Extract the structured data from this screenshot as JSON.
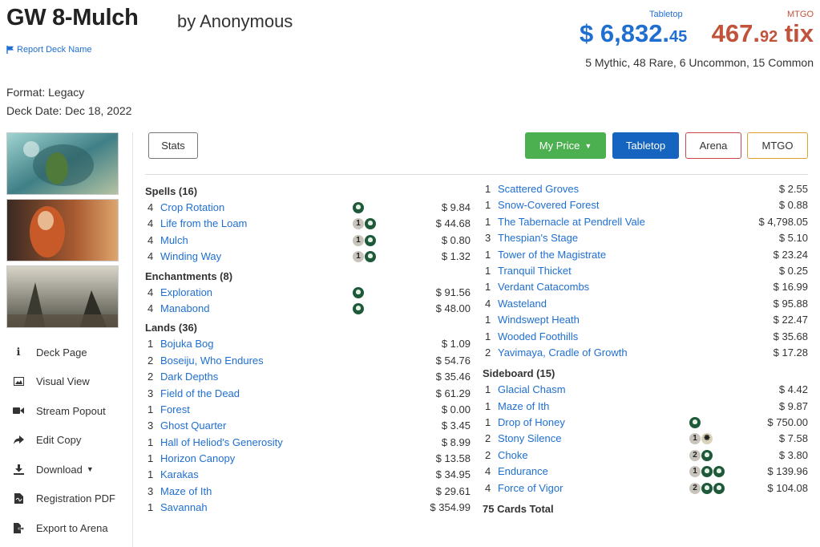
{
  "header": {
    "title": "GW 8-Mulch",
    "author": "by Anonymous",
    "report_link": "Report Deck Name",
    "tabletop_label": "Tabletop",
    "mtgo_label": "MTGO",
    "tabletop_price_main": "$ 6,832.",
    "tabletop_price_cents": "45",
    "mtgo_price_main": "467.",
    "mtgo_price_cents": "92",
    "mtgo_price_unit": " tix",
    "rarity_summary": "5 Mythic, 48 Rare, 6 Uncommon, 15 Common"
  },
  "meta": {
    "format": "Format: Legacy",
    "deck_date": "Deck Date: Dec 18, 2022"
  },
  "sidebar": {
    "menu": [
      {
        "label": "Deck Page",
        "icon": "info-icon"
      },
      {
        "label": "Visual View",
        "icon": "image-icon"
      },
      {
        "label": "Stream Popout",
        "icon": "video-icon"
      },
      {
        "label": "Edit Copy",
        "icon": "share-icon"
      },
      {
        "label": "Download",
        "icon": "download-icon"
      },
      {
        "label": "Registration PDF",
        "icon": "pdf-icon"
      },
      {
        "label": "Export to Arena",
        "icon": "export-icon"
      }
    ]
  },
  "toolbar": {
    "stats": "Stats",
    "my_price": "My Price",
    "tabletop": "Tabletop",
    "arena": "Arena",
    "mtgo": "MTGO"
  },
  "colors": {
    "tabletop_blue": "#1f6fd1",
    "mtgo_red": "#c0533a",
    "my_price_green": "#4caf50",
    "active_blue": "#1565c0"
  },
  "sections": {
    "spells": {
      "title": "Spells (16)",
      "cards": [
        {
          "qty": "4",
          "name": "Crop Rotation",
          "mana": [
            "G"
          ],
          "price": "$ 9.84"
        },
        {
          "qty": "4",
          "name": "Life from the Loam",
          "mana": [
            "1",
            "G"
          ],
          "price": "$ 44.68"
        },
        {
          "qty": "4",
          "name": "Mulch",
          "mana": [
            "1",
            "G"
          ],
          "price": "$ 0.80"
        },
        {
          "qty": "4",
          "name": "Winding Way",
          "mana": [
            "1",
            "G"
          ],
          "price": "$ 1.32"
        }
      ]
    },
    "enchantments": {
      "title": "Enchantments (8)",
      "cards": [
        {
          "qty": "4",
          "name": "Exploration",
          "mana": [
            "G"
          ],
          "price": "$ 91.56"
        },
        {
          "qty": "4",
          "name": "Manabond",
          "mana": [
            "G"
          ],
          "price": "$ 48.00"
        }
      ]
    },
    "lands": {
      "title": "Lands (36)",
      "cards": [
        {
          "qty": "1",
          "name": "Bojuka Bog",
          "price": "$ 1.09"
        },
        {
          "qty": "2",
          "name": "Boseiju, Who Endures",
          "price": "$ 54.76"
        },
        {
          "qty": "2",
          "name": "Dark Depths",
          "price": "$ 35.46"
        },
        {
          "qty": "3",
          "name": "Field of the Dead",
          "price": "$ 61.29"
        },
        {
          "qty": "1",
          "name": "Forest",
          "price": "$ 0.00"
        },
        {
          "qty": "3",
          "name": "Ghost Quarter",
          "price": "$ 3.45"
        },
        {
          "qty": "1",
          "name": "Hall of Heliod's Generosity",
          "price": "$ 8.99"
        },
        {
          "qty": "1",
          "name": "Horizon Canopy",
          "price": "$ 13.58"
        },
        {
          "qty": "1",
          "name": "Karakas",
          "price": "$ 34.95"
        },
        {
          "qty": "3",
          "name": "Maze of Ith",
          "price": "$ 29.61"
        },
        {
          "qty": "1",
          "name": "Savannah",
          "price": "$ 354.99"
        }
      ],
      "continued": [
        {
          "qty": "1",
          "name": "Scattered Groves",
          "price": "$ 2.55"
        },
        {
          "qty": "1",
          "name": "Snow-Covered Forest",
          "price": "$ 0.88"
        },
        {
          "qty": "1",
          "name": "The Tabernacle at Pendrell Vale",
          "price": "$ 4,798.05"
        },
        {
          "qty": "3",
          "name": "Thespian's Stage",
          "price": "$ 5.10"
        },
        {
          "qty": "1",
          "name": "Tower of the Magistrate",
          "price": "$ 23.24"
        },
        {
          "qty": "1",
          "name": "Tranquil Thicket",
          "price": "$ 0.25"
        },
        {
          "qty": "1",
          "name": "Verdant Catacombs",
          "price": "$ 16.99"
        },
        {
          "qty": "4",
          "name": "Wasteland",
          "price": "$ 95.88"
        },
        {
          "qty": "1",
          "name": "Windswept Heath",
          "price": "$ 22.47"
        },
        {
          "qty": "1",
          "name": "Wooded Foothills",
          "price": "$ 35.68"
        },
        {
          "qty": "2",
          "name": "Yavimaya, Cradle of Growth",
          "price": "$ 17.28"
        }
      ]
    },
    "sideboard": {
      "title": "Sideboard (15)",
      "cards": [
        {
          "qty": "1",
          "name": "Glacial Chasm",
          "price": "$ 4.42"
        },
        {
          "qty": "1",
          "name": "Maze of Ith",
          "price": "$ 9.87"
        },
        {
          "qty": "1",
          "name": "Drop of Honey",
          "mana": [
            "G"
          ],
          "price": "$ 750.00"
        },
        {
          "qty": "2",
          "name": "Stony Silence",
          "mana": [
            "1",
            "W"
          ],
          "price": "$ 7.58"
        },
        {
          "qty": "2",
          "name": "Choke",
          "mana": [
            "2",
            "G"
          ],
          "price": "$ 3.80"
        },
        {
          "qty": "4",
          "name": "Endurance",
          "mana": [
            "1",
            "G",
            "G"
          ],
          "price": "$ 139.96"
        },
        {
          "qty": "4",
          "name": "Force of Vigor",
          "mana": [
            "2",
            "G",
            "G"
          ],
          "price": "$ 104.08"
        }
      ]
    }
  },
  "total": "75 Cards Total"
}
